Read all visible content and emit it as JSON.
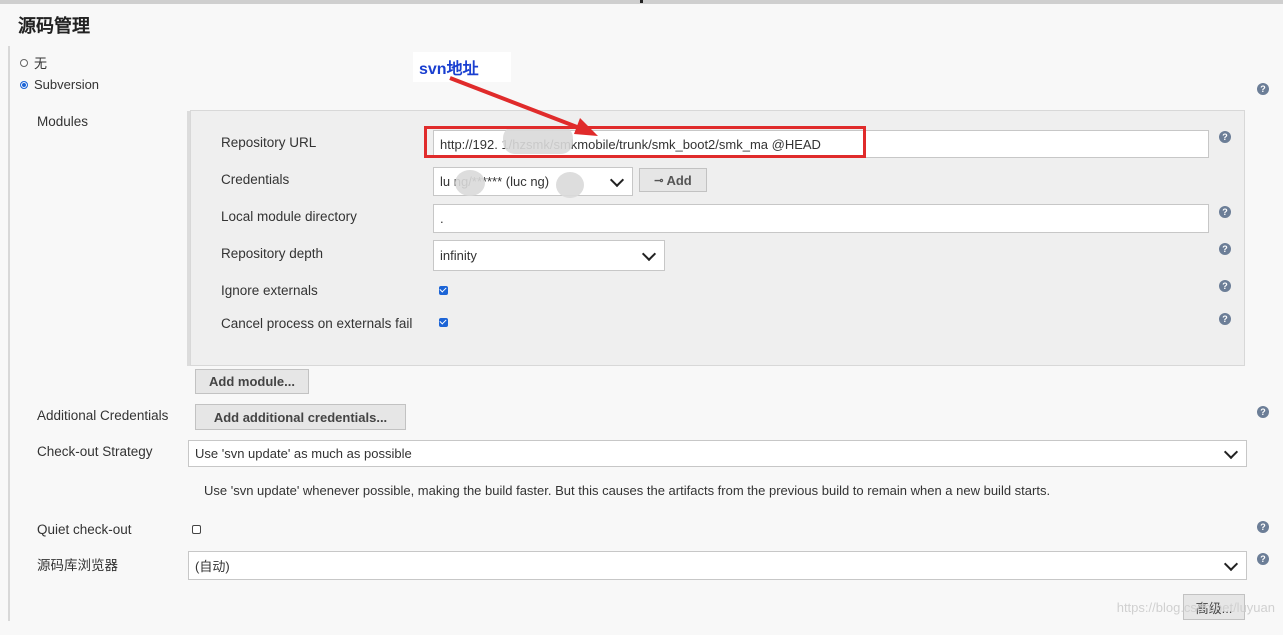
{
  "page_title": "源码管理",
  "scm_options": [
    {
      "label": "无",
      "selected": false
    },
    {
      "label": "Subversion",
      "selected": true
    }
  ],
  "annotation": {
    "text": "svn地址",
    "color": "#e02b2b"
  },
  "modules": {
    "section_label": "Modules",
    "repository_url": {
      "label": "Repository URL",
      "value": "http://192.          1/hzsmk/smkmobile/trunk/smk_boot2/smk_ma   @HEAD"
    },
    "credentials": {
      "label": "Credentials",
      "value": "lu      ng/****** (luc    ng)",
      "add_label": "Add"
    },
    "local_module_directory": {
      "label": "Local module directory",
      "value": "."
    },
    "repository_depth": {
      "label": "Repository depth",
      "value": "infinity"
    },
    "ignore_externals": {
      "label": "Ignore externals",
      "checked": true
    },
    "cancel_process": {
      "label": "Cancel process on externals fail",
      "checked": true
    },
    "add_module_label": "Add module..."
  },
  "additional_credentials": {
    "label": "Additional Credentials",
    "button": "Add additional credentials..."
  },
  "checkout_strategy": {
    "label": "Check-out Strategy",
    "value": "Use 'svn update' as much as possible",
    "description": "Use 'svn update' whenever possible, making the build faster. But this causes the artifacts from the previous build to remain when a new build starts."
  },
  "quiet_checkout": {
    "label": "Quiet check-out",
    "checked": false
  },
  "repo_browser": {
    "label": "源码库浏览器",
    "value": "(自动)"
  },
  "advanced_button": "高级...",
  "watermark": "https://blog.csdn.net/luyuan",
  "colors": {
    "accent": "#1c64d6",
    "annotation_red": "#e02b2b",
    "annotation_blue": "#1a3fd0"
  }
}
